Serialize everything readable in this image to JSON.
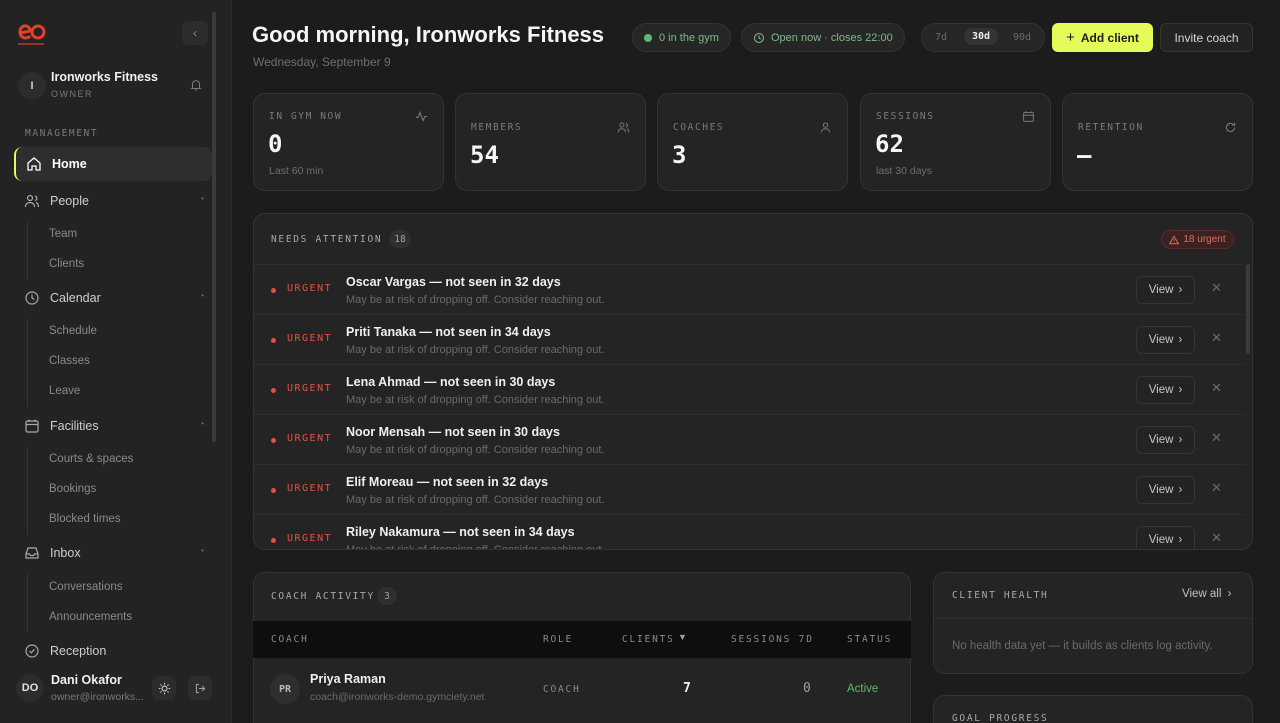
{
  "sidebar": {
    "org": {
      "avatar": "I",
      "name": "Ironworks Fitness",
      "role": "OWNER"
    },
    "section": "MANAGEMENT",
    "nav": [
      {
        "label": "Home",
        "icon": "home-icon"
      },
      {
        "label": "People",
        "icon": "people-icon",
        "children": [
          "Team",
          "Clients"
        ]
      },
      {
        "label": "Calendar",
        "icon": "clock-icon",
        "children": [
          "Schedule",
          "Classes",
          "Leave"
        ]
      },
      {
        "label": "Facilities",
        "icon": "calendar-icon",
        "children": [
          "Courts & spaces",
          "Bookings",
          "Blocked times"
        ]
      },
      {
        "label": "Inbox",
        "icon": "inbox-icon",
        "children": [
          "Conversations",
          "Announcements"
        ]
      },
      {
        "label": "Reception",
        "icon": "check-circle-icon"
      }
    ],
    "user": {
      "initials": "DO",
      "name": "Dani Okafor",
      "email": "owner@ironworks..."
    }
  },
  "header": {
    "greeting": "Good morning, Ironworks Fitness",
    "date": "Wednesday, September 9",
    "in_gym_pill": "0 in the gym",
    "open_pill": "Open now · closes 22:00",
    "ranges": [
      "7d",
      "30d",
      "90d"
    ],
    "selected_range": "30d",
    "add_client": "Add client",
    "invite_coach": "Invite coach"
  },
  "stats": [
    {
      "label": "IN GYM NOW",
      "value": "0",
      "sub": "Last 60 min",
      "icon": "pulse-icon"
    },
    {
      "label": "MEMBERS",
      "value": "54",
      "sub": "",
      "icon": "members-icon"
    },
    {
      "label": "COACHES",
      "value": "3",
      "sub": "",
      "icon": "person-icon"
    },
    {
      "label": "SESSIONS",
      "value": "62",
      "sub": "last 30 days",
      "icon": "calendar-icon"
    },
    {
      "label": "RETENTION",
      "value": "—",
      "sub": "",
      "icon": "refresh-icon"
    }
  ],
  "attention": {
    "title": "NEEDS ATTENTION",
    "count": "18",
    "urgent_badge": "18 urgent",
    "view_label": "View",
    "items": [
      {
        "tag": "URGENT",
        "title": "Oscar Vargas — not seen in 32 days",
        "desc": "May be at risk of dropping off. Consider reaching out."
      },
      {
        "tag": "URGENT",
        "title": "Priti Tanaka — not seen in 34 days",
        "desc": "May be at risk of dropping off. Consider reaching out."
      },
      {
        "tag": "URGENT",
        "title": "Lena Ahmad — not seen in 30 days",
        "desc": "May be at risk of dropping off. Consider reaching out."
      },
      {
        "tag": "URGENT",
        "title": "Noor Mensah — not seen in 30 days",
        "desc": "May be at risk of dropping off. Consider reaching out."
      },
      {
        "tag": "URGENT",
        "title": "Elif Moreau — not seen in 32 days",
        "desc": "May be at risk of dropping off. Consider reaching out."
      },
      {
        "tag": "URGENT",
        "title": "Riley Nakamura — not seen in 34 days",
        "desc": "May be at risk of dropping off. Consider reaching out."
      }
    ]
  },
  "coach_activity": {
    "title": "COACH ACTIVITY",
    "count": "3",
    "columns": [
      "COACH",
      "ROLE",
      "CLIENTS",
      "SESSIONS 7D",
      "STATUS"
    ],
    "rows": [
      {
        "initials": "PR",
        "name": "Priya Raman",
        "email": "coach@ironworks-demo.gymciety.net",
        "role": "COACH",
        "clients": "7",
        "sessions": "0",
        "status": "Active"
      }
    ]
  },
  "client_health": {
    "title": "CLIENT HEALTH",
    "view_all": "View all",
    "empty": "No health data yet — it builds as clients log activity."
  },
  "goal_progress": {
    "title": "GOAL PROGRESS"
  },
  "colors": {
    "accent": "#e6fa5a",
    "urgent": "#e0533f",
    "success": "#5fb86e"
  }
}
